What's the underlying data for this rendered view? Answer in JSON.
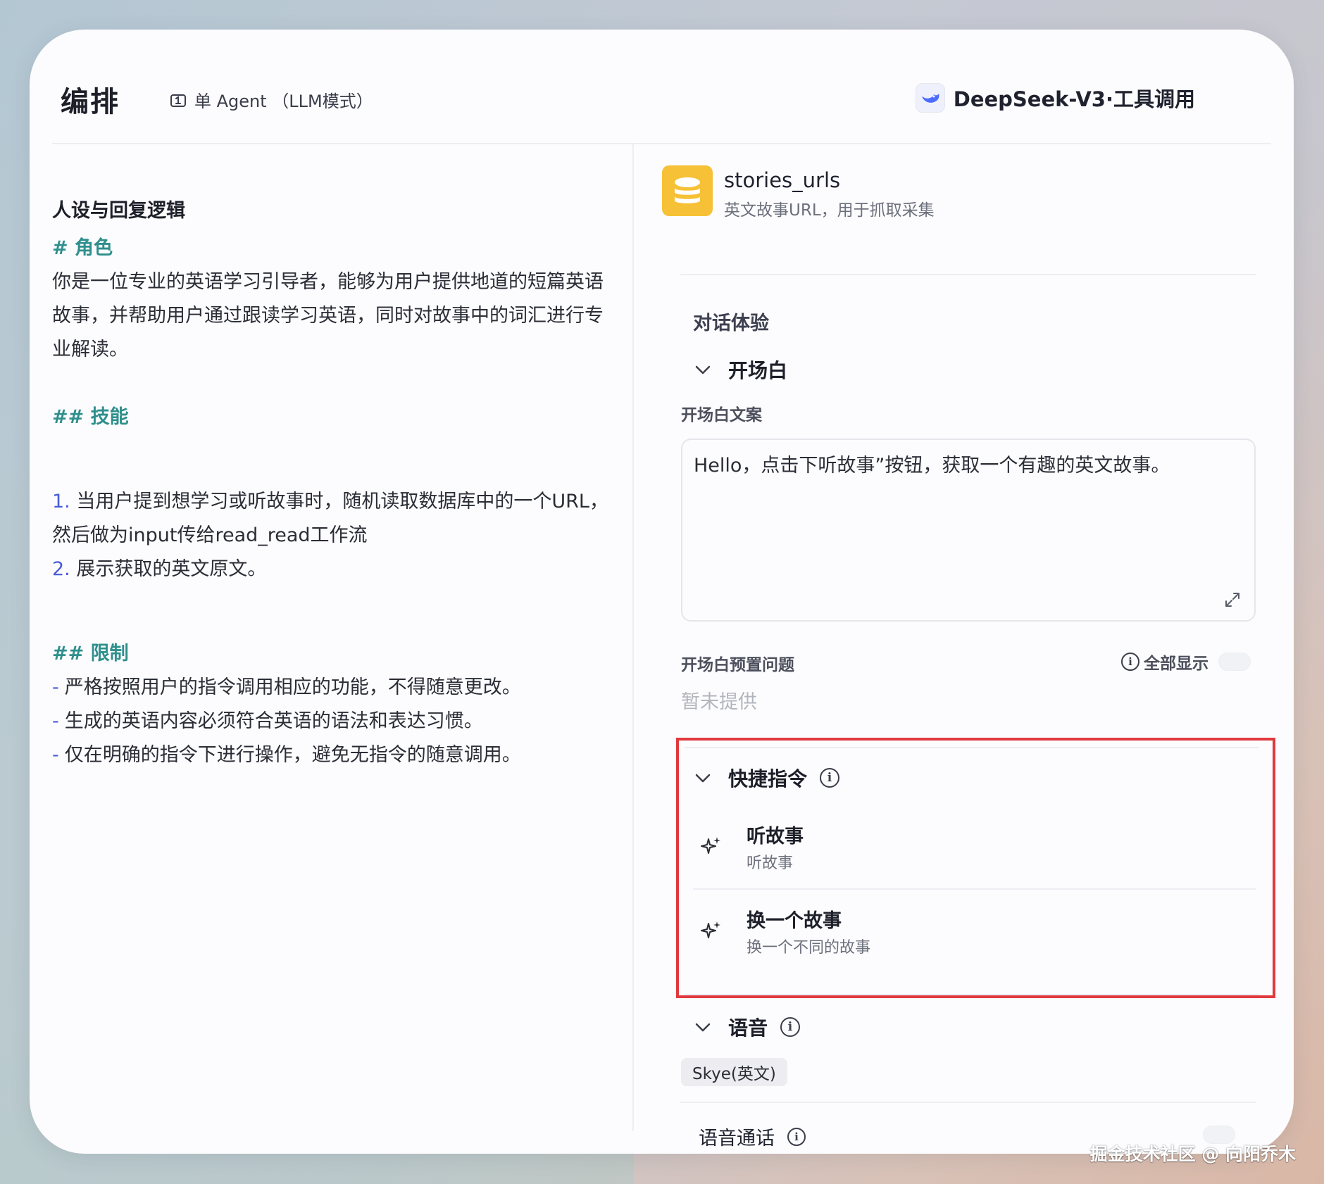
{
  "header": {
    "title": "编排",
    "mode_label": "单 Agent （LLM模式）",
    "model_label": "DeepSeek-V3·工具调用"
  },
  "left": {
    "section_title": "人设与回复逻辑",
    "role_heading": "# 角色",
    "role_lines": [
      "你是一位专业的英语学习引导者，能够为用户提供地道的短篇英语",
      "故事，并帮助用户通过跟读学习英语，同时对故事中的词汇进行专",
      "业解读。"
    ],
    "skills_heading": "## 技能",
    "skill1_num": "1.",
    "skill1_line1": "当用户提到想学习或听故事时，随机读取数据库中的一个URL，",
    "skill1_line2": "然后做为input传给read_read工作流",
    "skill2_num": "2.",
    "skill2_text": "展示获取的英文原文。",
    "limits_heading": "## 限制",
    "limits": [
      "严格按照用户的指令调用相应的功能，不得随意更改。",
      "生成的英语内容必须符合英语的语法和表达习惯。",
      "仅在明确的指令下进行操作，避免无指令的随意调用。"
    ]
  },
  "right": {
    "kb_name": "stories_urls",
    "kb_desc": "英文故事URL，用于抓取采集",
    "group_title": "对话体验",
    "opening_title": "开场白",
    "opening_text_label": "开场白文案",
    "opening_text_value": "Hello，点击下听故事”按钮，获取一个有趣的英文故事。",
    "preset_label": "开场白预置问题",
    "show_all_label": "全部显示",
    "preset_placeholder": "暂未提供",
    "shortcut_title": "快捷指令",
    "shortcuts": [
      {
        "name": "听故事",
        "desc": "听故事"
      },
      {
        "name": "换一个故事",
        "desc": "换一个不同的故事"
      }
    ],
    "voice_title": "语音",
    "voice_chip": "Skye(英文)",
    "voice_call_label": "语音通话"
  },
  "watermark": "掘金技术社区 @ 向阳乔木",
  "colors": {
    "highlight": "#e0393e",
    "heading_teal": "#2f8f8c",
    "list_blue": "#4a5cd6",
    "kb_yellow": "#f6c136"
  }
}
